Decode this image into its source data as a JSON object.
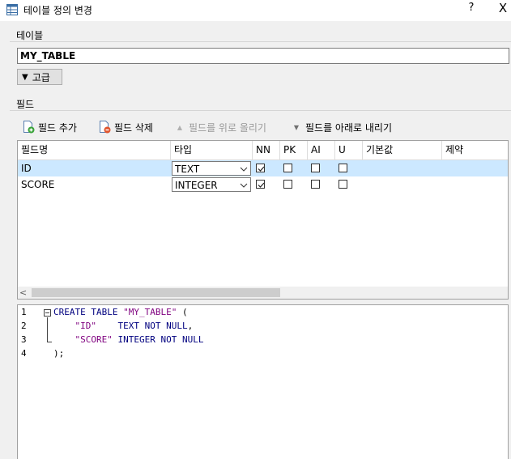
{
  "window": {
    "title": "테이블 정의 변경",
    "help": "?",
    "close": "X"
  },
  "table_section": {
    "label": "테이블",
    "name_value": "MY_TABLE",
    "advanced_label": "고급"
  },
  "fields_section": {
    "label": "필드",
    "toolbar": {
      "add": "필드 추가",
      "delete": "필드 삭제",
      "move_up": "필드를 위로 올리기",
      "move_down": "필드를 아래로 내리기"
    },
    "columns": {
      "name": "필드명",
      "type": "타입",
      "nn": "NN",
      "pk": "PK",
      "ai": "AI",
      "u": "U",
      "default": "기본값",
      "constraint": "제약"
    },
    "rows": [
      {
        "name": "ID",
        "type": "TEXT",
        "nn": true,
        "pk": false,
        "ai": false,
        "u": false,
        "default": "",
        "constraint": "",
        "selected": true
      },
      {
        "name": "SCORE",
        "type": "INTEGER",
        "nn": true,
        "pk": false,
        "ai": false,
        "u": false,
        "default": "",
        "constraint": "",
        "selected": false
      }
    ],
    "scroll_left": "<"
  },
  "sql_editor": {
    "line_numbers": [
      "1",
      "2",
      "3",
      "4"
    ],
    "lines": [
      {
        "kw1": "CREATE TABLE ",
        "str": "\"MY_TABLE\"",
        "rest": " ("
      },
      {
        "indent": "    ",
        "str": "\"ID\"",
        "gap": "    ",
        "kw": "TEXT NOT NULL",
        "rest": ","
      },
      {
        "indent": "    ",
        "str": "\"SCORE\"",
        "gap": " ",
        "kw": "INTEGER NOT NULL",
        "rest": ""
      },
      {
        "rest": ");"
      }
    ]
  },
  "colors": {
    "selection": "#cce8ff",
    "keyword": "#00007f",
    "string": "#7f007f"
  }
}
